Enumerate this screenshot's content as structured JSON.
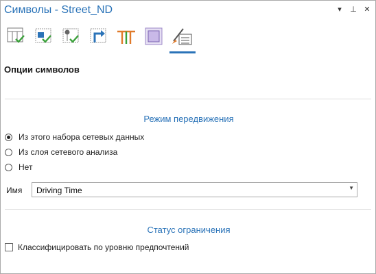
{
  "window": {
    "title": "Символы - Street_ND",
    "controls": {
      "menu": "▾",
      "pin": "⊥",
      "close": "✕"
    }
  },
  "toolbar": {
    "active_index": 5,
    "icons": [
      "turn-table-icon",
      "network-source-icon",
      "junction-check-icon",
      "turn-arrow-icon",
      "restriction-lines-icon",
      "polygon-barrier-icon",
      "symbology-options-icon"
    ]
  },
  "section": {
    "title": "Опции символов"
  },
  "travel_mode": {
    "header": "Режим передвижения",
    "options": [
      {
        "label": "Из этого набора сетевых данных",
        "checked": true
      },
      {
        "label": "Из слоя сетевого анализа",
        "checked": false
      },
      {
        "label": "Нет",
        "checked": false
      }
    ],
    "name_label": "Имя",
    "name_value": "Driving Time"
  },
  "restriction": {
    "header": "Статус ограничения",
    "checkbox_label": "Классифицировать по уровню предпочтений",
    "checked": false
  },
  "colors": {
    "accent": "#2a73b8",
    "green_check": "#3aa13a",
    "orange": "#e07a2a"
  }
}
